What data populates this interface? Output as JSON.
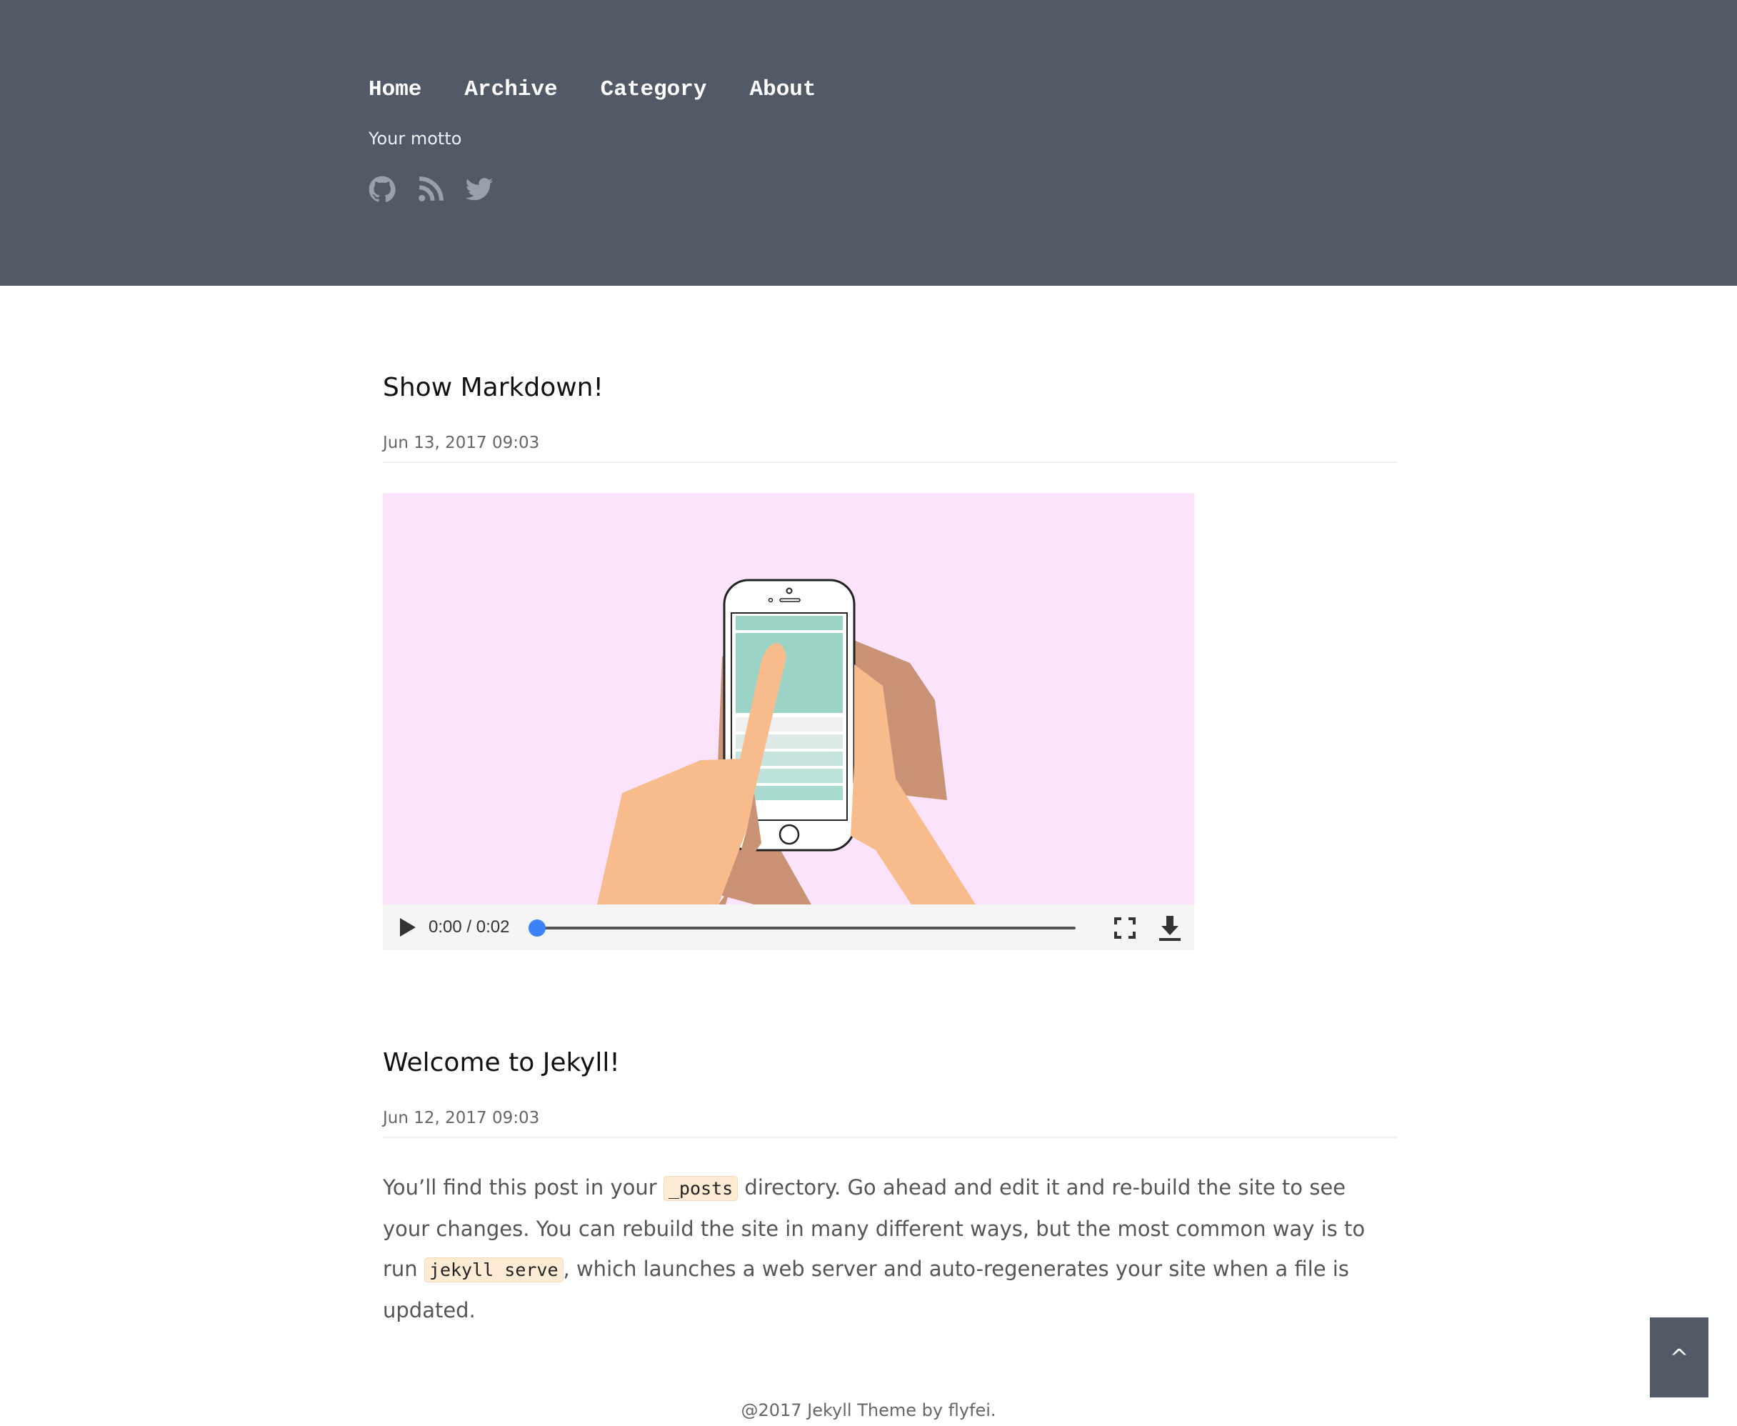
{
  "header": {
    "nav": [
      "Home",
      "Archive",
      "Category",
      "About"
    ],
    "motto": "Your motto",
    "social_icons": [
      "github-icon",
      "rss-icon",
      "twitter-icon"
    ],
    "background_color": "#525967"
  },
  "posts": [
    {
      "title": "Show Markdown!",
      "date": "Jun 13, 2017 09:03",
      "video": {
        "time": "0:00 / 0:02",
        "progress": 0
      }
    },
    {
      "title": "Welcome to Jekyll!",
      "date": "Jun 12, 2017 09:03",
      "paragraph": {
        "part1": "You’ll find this post in your ",
        "code1": "_posts",
        "part2": " directory. Go ahead and edit it and re-build the site to see your changes. You can rebuild the site in many different ways, but the most common way is to run ",
        "code2": "jekyll serve",
        "part3": ", which launches a web server and auto-regenerates your site when a file is updated."
      }
    }
  ],
  "back_to_top": "^",
  "footer": "@2017 Jekyll Theme by flyfei."
}
